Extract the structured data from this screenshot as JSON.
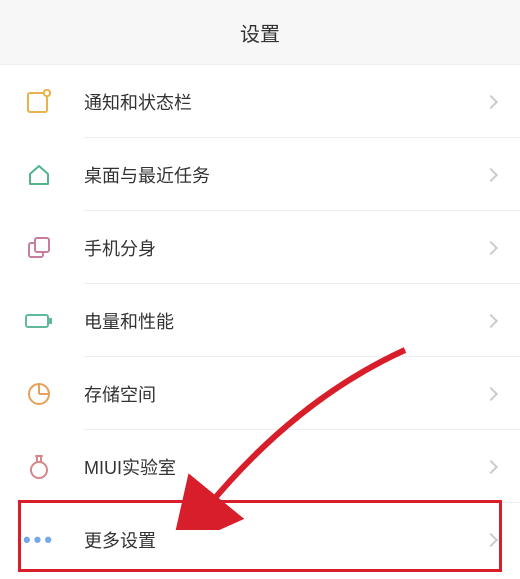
{
  "header": {
    "title": "设置"
  },
  "rows": [
    {
      "key": "notifications",
      "icon": "badge-icon",
      "label": "通知和状态栏"
    },
    {
      "key": "home-recents",
      "icon": "home-icon",
      "label": "桌面与最近任务"
    },
    {
      "key": "second-space",
      "icon": "clone-icon",
      "label": "手机分身"
    },
    {
      "key": "battery-perf",
      "icon": "battery-icon",
      "label": "电量和性能"
    },
    {
      "key": "storage",
      "icon": "storage-icon",
      "label": "存储空间"
    },
    {
      "key": "miui-lab",
      "icon": "flask-icon",
      "label": "MIUI实验室"
    },
    {
      "key": "more-settings",
      "icon": "more-icon",
      "label": "更多设置"
    }
  ],
  "annotation": {
    "highlight_row_key": "more-settings",
    "arrow_color": "#d81e2a"
  }
}
